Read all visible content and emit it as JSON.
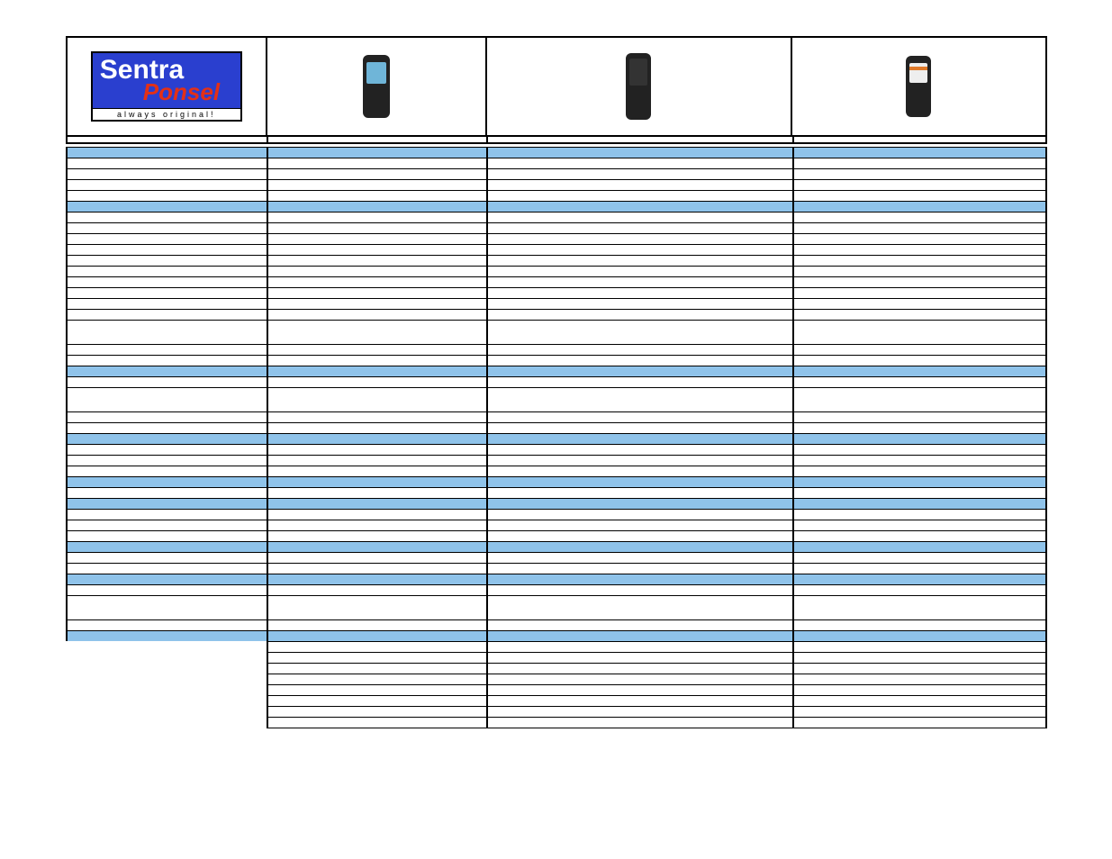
{
  "logo": {
    "line1": "Sentra",
    "line2": "Ponsel",
    "tagline": "always original!"
  },
  "products": [
    {
      "id": "phone-1",
      "icon": "candybar-phone-blue-screen"
    },
    {
      "id": "phone-2",
      "icon": "candybar-phone-dark"
    },
    {
      "id": "phone-3",
      "icon": "candybar-phone-light-screen"
    }
  ],
  "rows": [
    {
      "type": "header-blue"
    },
    {
      "type": "data"
    },
    {
      "type": "data"
    },
    {
      "type": "data"
    },
    {
      "type": "data"
    },
    {
      "type": "header-blue"
    },
    {
      "type": "data"
    },
    {
      "type": "data"
    },
    {
      "type": "data"
    },
    {
      "type": "data"
    },
    {
      "type": "data"
    },
    {
      "type": "data"
    },
    {
      "type": "data"
    },
    {
      "type": "data"
    },
    {
      "type": "data"
    },
    {
      "type": "data"
    },
    {
      "type": "data-tall"
    },
    {
      "type": "data"
    },
    {
      "type": "data"
    },
    {
      "type": "header-blue"
    },
    {
      "type": "data"
    },
    {
      "type": "data-tall"
    },
    {
      "type": "data"
    },
    {
      "type": "data"
    },
    {
      "type": "header-blue"
    },
    {
      "type": "data"
    },
    {
      "type": "data"
    },
    {
      "type": "data"
    },
    {
      "type": "header-blue"
    },
    {
      "type": "data"
    },
    {
      "type": "header-blue"
    },
    {
      "type": "data"
    },
    {
      "type": "data"
    },
    {
      "type": "data"
    },
    {
      "type": "header-blue"
    },
    {
      "type": "data"
    },
    {
      "type": "data"
    },
    {
      "type": "header-blue"
    },
    {
      "type": "data"
    },
    {
      "type": "data-tall"
    },
    {
      "type": "data"
    },
    {
      "type": "header-blue"
    },
    {
      "type": "data-nocol1"
    },
    {
      "type": "data-nocol1"
    },
    {
      "type": "data-nocol1"
    },
    {
      "type": "data-nocol1"
    },
    {
      "type": "data-nocol1"
    },
    {
      "type": "data-nocol1"
    },
    {
      "type": "data-nocol1"
    },
    {
      "type": "data-nocol1"
    }
  ]
}
